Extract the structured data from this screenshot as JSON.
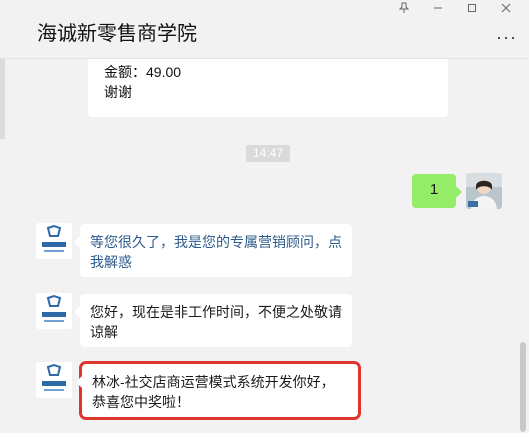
{
  "window": {
    "title": "海诚新零售商学院",
    "more_label": "···"
  },
  "card": {
    "amount": "金额：49.00",
    "thanks": "谢谢"
  },
  "timestamp": "14:47",
  "messages": [
    {
      "side": "right",
      "text": "1",
      "avatar": "user-photo-avatar"
    },
    {
      "side": "left",
      "text": "等您很久了，我是您的专属营销顾问，点我解惑",
      "avatar": "brand-logo-avatar"
    },
    {
      "side": "left",
      "text": "您好，现在是非工作时间，不便之处敬请谅解",
      "avatar": "brand-logo-avatar"
    },
    {
      "side": "left",
      "text": "林冰-社交店商运营模式系统开发你好，恭喜您中奖啦！",
      "avatar": "brand-logo-avatar",
      "highlighted": true
    }
  ],
  "colors": {
    "background": "#f2f2f2",
    "bubble_self": "#95ec69",
    "bubble_other": "#ffffff",
    "highlight": "#e0342c",
    "link_text": "#2d5a8c"
  },
  "icons": [
    "pin-icon",
    "minimize-icon",
    "maximize-icon",
    "close-icon",
    "more-icon"
  ]
}
